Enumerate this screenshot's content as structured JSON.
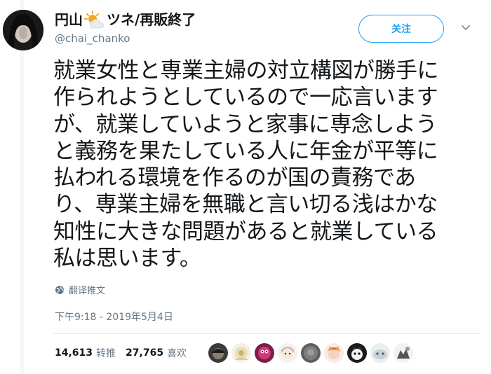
{
  "user": {
    "name_before": "円山",
    "name_after": "ツネ/再販終了",
    "handle": "@chai_chanko"
  },
  "follow_label": "关注",
  "tweet_lines": [
    "就業女性と専業主婦の対立構図が勝手に",
    "作られようとしているので一応言います",
    "が、就業していようと家事に専念しよう",
    "と義務を果たしている人に年金が平等に",
    "払われる環境を作るのが国の責務であ",
    "り、専業主婦を無職と言い切る浅はかな",
    "知性に大きな問題があると就業している",
    "私は思います。"
  ],
  "translate_label": "翻译推文",
  "timestamp": "下午9:18 - 2019年5月4日",
  "stats": {
    "retweets": "14,613",
    "retweets_label": "转推",
    "likes": "27,765",
    "likes_label": "喜欢"
  },
  "colors": {
    "accent": "#1da1f2",
    "secondary_text": "#657786",
    "divider": "#e1e8ed"
  },
  "liker_avatar_icons": [
    "avatar-1",
    "avatar-2",
    "avatar-3",
    "avatar-4",
    "avatar-5",
    "avatar-6",
    "avatar-7",
    "avatar-8",
    "avatar-9"
  ]
}
